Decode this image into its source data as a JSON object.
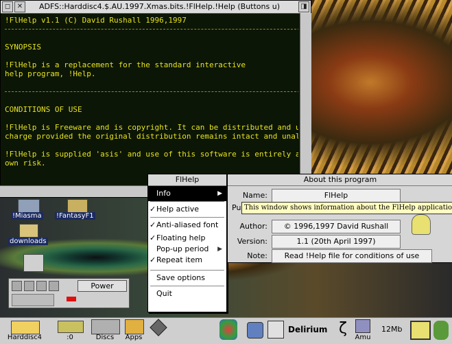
{
  "text_window": {
    "title": "ADFS::Harddisc4.$.AU.1997.Xmas.bits.!FlHelp.!Help (Buttons u)",
    "lines": [
      "!FlHelp v1.1 (C) David Rushall 1996,1997",
      "",
      "",
      "SYNOPSIS",
      "",
      "!FlHelp is a replacement for the standard interactive",
      "help program, !Help.",
      "",
      "",
      "CONDITIONS OF USE",
      "",
      "!FlHelp is Freeware and is copyright. It can be distributed and u",
      "charge provided the original distribution remains intact and unal",
      "",
      "!FlHelp is supplied 'asis' and use of this software is entirely a",
      "own risk."
    ]
  },
  "pinboard": {
    "miasma": "!Miasma",
    "fantasy": "!FantasyF1",
    "downloads": "downloads"
  },
  "power_panel": {
    "label": "Power"
  },
  "menu": {
    "title": "FlHelp",
    "items": [
      {
        "label": "Info",
        "tick": "",
        "arrow": "▶"
      },
      {
        "label": "Help active",
        "tick": "✓",
        "arrow": ""
      },
      {
        "label": "Anti-aliased font",
        "tick": "✓",
        "arrow": ""
      },
      {
        "label": "Floating help",
        "tick": "✓",
        "arrow": ""
      },
      {
        "label": "Pop-up period",
        "tick": "",
        "arrow": "▶"
      },
      {
        "label": "Repeat item",
        "tick": "✓",
        "arrow": ""
      },
      {
        "label": "Save options",
        "tick": "",
        "arrow": ""
      },
      {
        "label": "Quit",
        "tick": "",
        "arrow": ""
      }
    ]
  },
  "about": {
    "title": "About this program",
    "name_label": "Name:",
    "name_value": "FlHelp",
    "purpose_label": "Pu",
    "author_label": "Author:",
    "author_value": "© 1996,1997 David Rushall",
    "version_label": "Version:",
    "version_value": "1.1 (20th April 1997)",
    "note_label": "Note:",
    "note_value": "Read !Help file for conditions of use"
  },
  "tooltip": "This window shows information about the FlHelp application",
  "iconbar": {
    "harddisc": "Harddisc4",
    "ram": ":0",
    "discs": "Discs",
    "apps": "Apps",
    "delirium": "Delirium",
    "amu": "Amu",
    "memory": "12Mb"
  }
}
